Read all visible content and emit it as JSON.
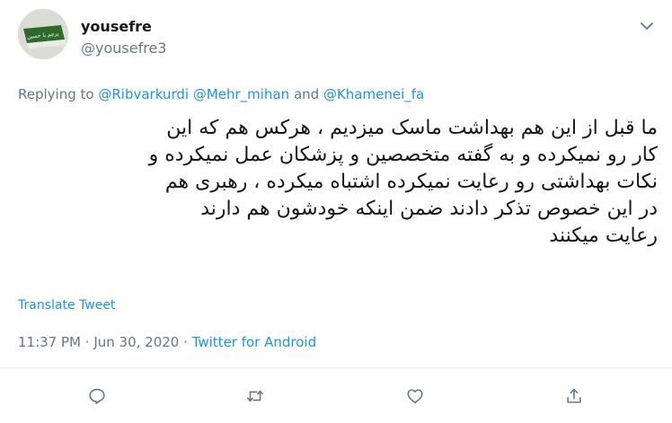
{
  "author": {
    "name": "yousefre",
    "handle": "@yousefre3",
    "avatar_text": "پرچم یا حسین"
  },
  "reply": {
    "prefix": "Replying to",
    "mention1": "@Ribvarkurdi",
    "mention2": "@Mehr_mihan",
    "and_text": "and",
    "mention3": "@Khamenei_fa"
  },
  "tweet": {
    "lines": [
      "ما قبل از این هم بهداشت ماسک میزدیم ، هرکس هم که این",
      "کار رو نمیکرده و به گفته متخصصین و پزشکان عمل نمیکرده و",
      "نکات بهداشتی رو رعایت نمیکرده اشتباه میکرده ، رهبری هم",
      "در این خصوص تذکر دادند ضمن اینکه خودشون هم دارند",
      "رعایت میکنند"
    ],
    "translate_label": "Translate Tweet",
    "time": "11:37 PM",
    "date": "Jun 30, 2020",
    "separator": "·",
    "source": "Twitter for Android"
  },
  "actions": {
    "reply_icon": "comment-icon",
    "retweet_icon": "retweet-icon",
    "like_icon": "heart-icon",
    "share_icon": "share-icon"
  },
  "colors": {
    "link": "#1b95e0",
    "muted": "#657786",
    "text": "#14171a",
    "avatar_flag": "#2f6a2a"
  }
}
